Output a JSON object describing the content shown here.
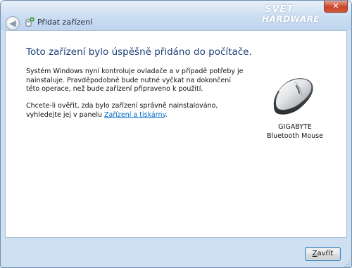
{
  "window": {
    "title": "Přidat zařízení",
    "close_glyph": "✕",
    "back_glyph": "◀"
  },
  "watermark": {
    "line1": "SVĚT",
    "line2": "HARDWARE"
  },
  "content": {
    "heading": "Toto zařízení bylo úspěšně přidáno do počítače.",
    "paragraph1": "Systém Windows nyní kontroluje ovladače a v případě potřeby je nainstaluje. Pravděpodobně bude nutné vyčkat na dokončení této operace, než bude zařízení připraveno k použití.",
    "paragraph2_before": "Chcete-li ověřit, zda bylo zařízení správně nainstalováno, vyhledejte jej v panelu ",
    "paragraph2_link": "Zařízení a tiskárny",
    "paragraph2_after": "."
  },
  "device": {
    "icon": "bluetooth-mouse-icon",
    "label": "GIGABYTE Bluetooth Mouse"
  },
  "footer": {
    "close_label_underlined": "Z",
    "close_label_rest": "avřít"
  },
  "colors": {
    "heading": "#1f3f7a",
    "link": "#0066cc",
    "frame": "#cfe0f3",
    "close_button": "#c7472d"
  }
}
